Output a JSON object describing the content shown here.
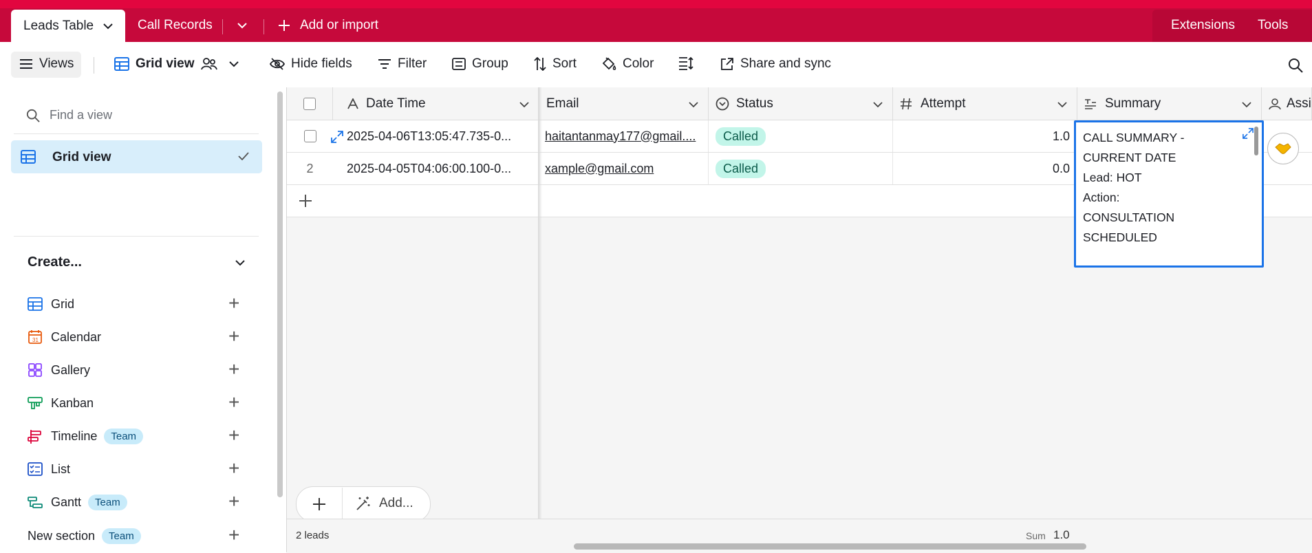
{
  "topbar": {
    "tabs": [
      {
        "label": "Leads Table"
      },
      {
        "label": "Call Records"
      }
    ],
    "add_import": "Add or import",
    "extensions": "Extensions",
    "tools": "Tools"
  },
  "toolbar": {
    "views": "Views",
    "current_view": "Grid view",
    "hide_fields": "Hide fields",
    "filter": "Filter",
    "group": "Group",
    "sort": "Sort",
    "color": "Color",
    "share": "Share and sync"
  },
  "sidebar": {
    "find_placeholder": "Find a view",
    "views": [
      {
        "label": "Grid view"
      }
    ],
    "create_label": "Create...",
    "create_items": [
      {
        "label": "Grid",
        "icon": "grid-icon",
        "color": "#1a73e8"
      },
      {
        "label": "Calendar",
        "icon": "calendar-icon",
        "color": "#e8590c"
      },
      {
        "label": "Gallery",
        "icon": "gallery-icon",
        "color": "#8b46ff"
      },
      {
        "label": "Kanban",
        "icon": "kanban-icon",
        "color": "#0f9d58"
      },
      {
        "label": "Timeline",
        "icon": "timeline-icon",
        "color": "#dc043b",
        "badge": "Team"
      },
      {
        "label": "List",
        "icon": "list-icon",
        "color": "#1a4fc7"
      },
      {
        "label": "Gantt",
        "icon": "gantt-icon",
        "color": "#0d8a78",
        "badge": "Team"
      }
    ],
    "new_section": "New section",
    "new_section_badge": "Team"
  },
  "grid": {
    "columns": [
      "Date Time",
      "Email",
      "Status",
      "Attempt",
      "Summary",
      "Assi"
    ],
    "rows": [
      {
        "num": "",
        "datetime": "2025-04-06T13:05:47.735-0...",
        "email": "haitantanmay177@gmail....",
        "status": "Called",
        "attempt": "1.0"
      },
      {
        "num": "2",
        "datetime": "2025-04-05T04:06:00.100-0...",
        "email": "xample@gmail.com",
        "status": "Called",
        "attempt": "0.0"
      }
    ],
    "summary_lines": [
      "CALL SUMMARY -",
      "CURRENT DATE",
      "Lead: HOT",
      "Action:",
      "CONSULTATION",
      "SCHEDULED"
    ],
    "add_label": "Add...",
    "record_count": "2 leads",
    "sum_label": "Sum",
    "sum_value": "1.0"
  },
  "colors": {
    "brand": "#c6093b",
    "accent": "#1a73e8",
    "selected": "#d8eefb",
    "pill": "#c2f5e9"
  }
}
